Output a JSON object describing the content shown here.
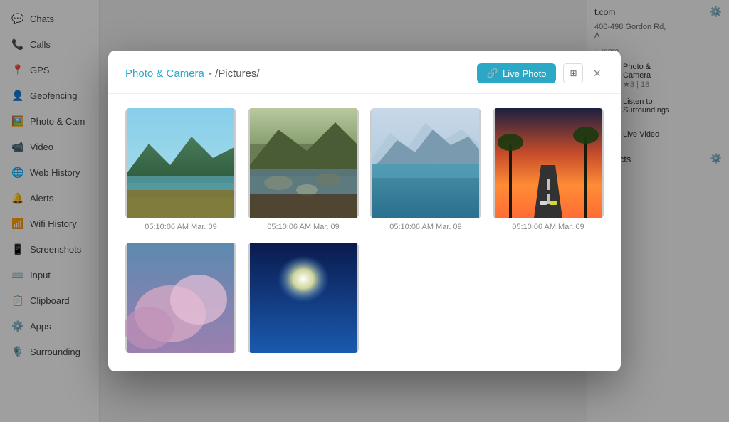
{
  "sidebar": {
    "items": [
      {
        "id": "chats",
        "label": "Chats",
        "icon": "💬"
      },
      {
        "id": "calls",
        "label": "Calls",
        "icon": "📞"
      },
      {
        "id": "gps",
        "label": "GPS",
        "icon": "📍"
      },
      {
        "id": "geofencing",
        "label": "Geofencing",
        "icon": "👤"
      },
      {
        "id": "photo-camera",
        "label": "Photo & Cam",
        "icon": "🖼️"
      },
      {
        "id": "video",
        "label": "Video",
        "icon": "📹"
      },
      {
        "id": "web-history",
        "label": "Web History",
        "icon": "🌐"
      },
      {
        "id": "alerts",
        "label": "Alerts",
        "icon": "🔔"
      },
      {
        "id": "wifi-history",
        "label": "Wifi History",
        "icon": "📶"
      },
      {
        "id": "screenshots",
        "label": "Screenshots",
        "icon": "📱"
      },
      {
        "id": "input",
        "label": "Input",
        "icon": "⌨️"
      },
      {
        "id": "clipboard",
        "label": "Clipboard",
        "icon": "📋"
      },
      {
        "id": "apps",
        "label": "Apps",
        "icon": "⚙️"
      },
      {
        "id": "surrounding",
        "label": "Surrounding",
        "icon": "🎙️"
      }
    ]
  },
  "modal": {
    "title_app": "Photo & Camera",
    "title_separator": " - ",
    "title_path": "/Pictures/",
    "live_photo_label": "Live Photo",
    "close_label": "×",
    "photos": [
      {
        "id": 1,
        "timestamp": "05:10:06 AM Mar. 09",
        "color1": "#4a7c59",
        "color2": "#7aab6e",
        "color3": "#8b6914"
      },
      {
        "id": 2,
        "timestamp": "05:10:06 AM Mar. 09",
        "color1": "#556b2f",
        "color2": "#4a3728",
        "color3": "#7a8c6e"
      },
      {
        "id": 3,
        "timestamp": "05:10:06 AM Mar. 09",
        "color1": "#4a90a4",
        "color2": "#7bbcd4",
        "color3": "#c8e8f0"
      },
      {
        "id": 4,
        "timestamp": "05:10:06 AM Mar. 09",
        "color1": "#ff6b35",
        "color2": "#c44a2a",
        "color3": "#1a1a2e"
      },
      {
        "id": 5,
        "timestamp": "",
        "color1": "#d4a8c4",
        "color2": "#9b7fb0",
        "color3": "#5c8ab0"
      },
      {
        "id": 6,
        "timestamp": "",
        "color1": "#1a3a6e",
        "color2": "#4a90d4",
        "color3": "#ffffff"
      }
    ]
  },
  "right_panel": {
    "website": "t.com",
    "address": "400-498 Gordon Rd,\nA",
    "more_label": "+ more",
    "items": [
      {
        "id": "photo-camera",
        "icon": "📷",
        "name": "Photo &\nCamera",
        "sub": "★3 | 18"
      },
      {
        "id": "surrounding",
        "icon": "🎙️",
        "name": "Listen to\nSurroundings",
        "sub": ""
      },
      {
        "id": "live-video",
        "icon": "📹",
        "name": "Live Video",
        "sub": ""
      }
    ],
    "contacts_label": "Contacts"
  }
}
